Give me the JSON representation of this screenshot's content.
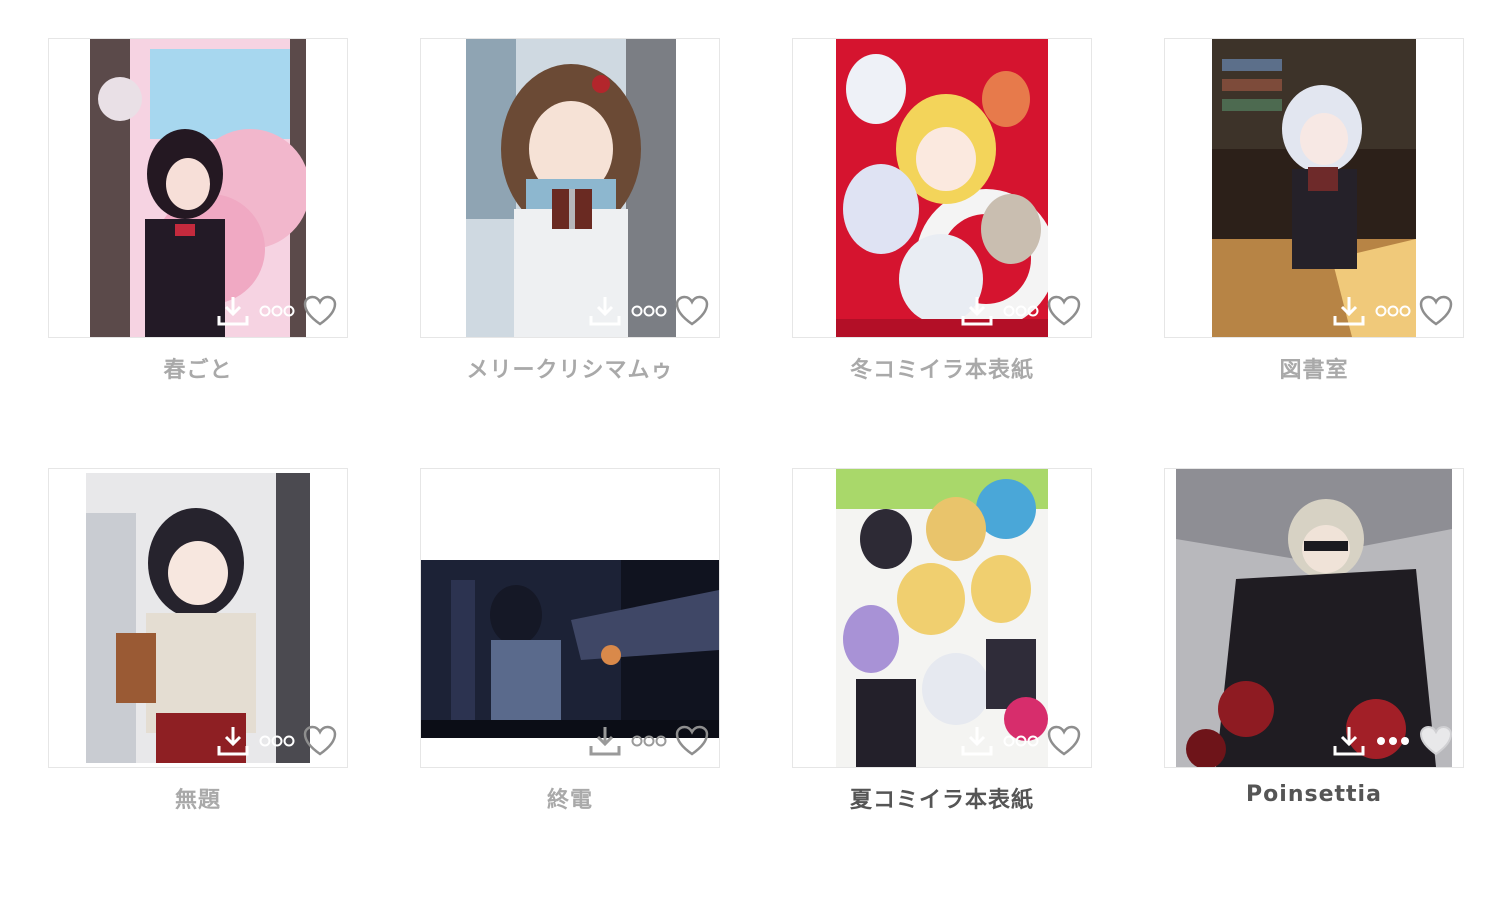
{
  "gallery": {
    "items": [
      {
        "title": "春ごと",
        "title_color": "#a9a9a9",
        "palette": [
          "#f4c6d8",
          "#9fd2ec",
          "#2a1c2a"
        ],
        "icon_color": "#ffffff"
      },
      {
        "title": "メリークリシマムゥ",
        "title_color": "#a9a9a9",
        "palette": [
          "#d9e3ea",
          "#7a5a44",
          "#eef2f5"
        ],
        "icon_color": "#ffffff"
      },
      {
        "title": "冬コミイラ本表紙",
        "title_color": "#a9a9a9",
        "palette": [
          "#c8102e",
          "#f5e06e",
          "#e8eef8"
        ],
        "icon_color": "#ffffff"
      },
      {
        "title": "図書室",
        "title_color": "#a9a9a9",
        "palette": [
          "#3a2a20",
          "#c89a54",
          "#e8ecf4"
        ],
        "icon_color": "#ffffff"
      },
      {
        "title": "無題",
        "title_color": "#a9a9a9",
        "palette": [
          "#e7e7ea",
          "#2b2834",
          "#a8572f"
        ],
        "icon_color": "#ffffff"
      },
      {
        "title": "終電",
        "title_color": "#a9a9a9",
        "palette": [
          "#1a1f35",
          "#3b4466",
          "#c46a3a"
        ],
        "icon_color": "#9a9a9a"
      },
      {
        "title": "夏コミイラ本表紙",
        "title_color": "#555555",
        "palette": [
          "#8fd14f",
          "#f3d772",
          "#2e2b3a"
        ],
        "icon_color": "#ffffff"
      },
      {
        "title": "Poinsettia",
        "title_color": "#555555",
        "palette": [
          "#b9b9bd",
          "#1e1b22",
          "#9d1c22"
        ],
        "icon_color": "#ffffff"
      }
    ],
    "icons": {
      "download": "download-icon",
      "more": "more-dots-icon",
      "like": "heart-icon"
    }
  }
}
